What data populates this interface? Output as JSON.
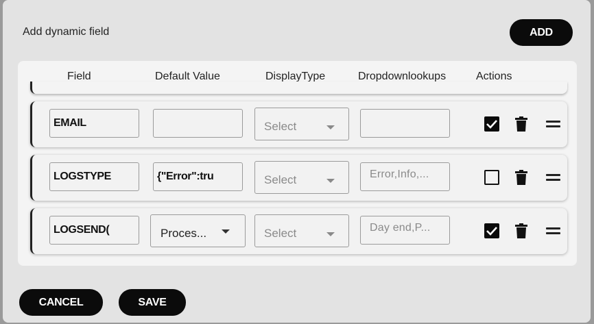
{
  "dialog": {
    "title": "Add dynamic field",
    "add_label": "ADD",
    "cancel_label": "CANCEL",
    "save_label": "SAVE"
  },
  "table": {
    "headers": {
      "field": "Field",
      "default_value": "Default Value",
      "display_type": "DisplayType",
      "dropdown_lookups": "Dropdownlookups",
      "actions": "Actions"
    },
    "rows": [
      {
        "field": "EMAIL",
        "default_value": "",
        "display_type": "Select",
        "dropdown_lookups": "",
        "checked": true
      },
      {
        "field": "LOGSTYPE",
        "default_value": "{\"Error\":tru",
        "display_type": "Select",
        "dropdown_lookups": "Error,Info,...",
        "checked": false
      },
      {
        "field": "LOGSEND(",
        "default_value": "Proces...",
        "display_type": "Select",
        "dropdown_lookups": "Day end,P...",
        "checked": true
      }
    ]
  },
  "icons": {
    "check": "check-icon",
    "delete": "trash-icon",
    "drag": "drag-handle-icon",
    "caret": "caret-down-icon"
  }
}
